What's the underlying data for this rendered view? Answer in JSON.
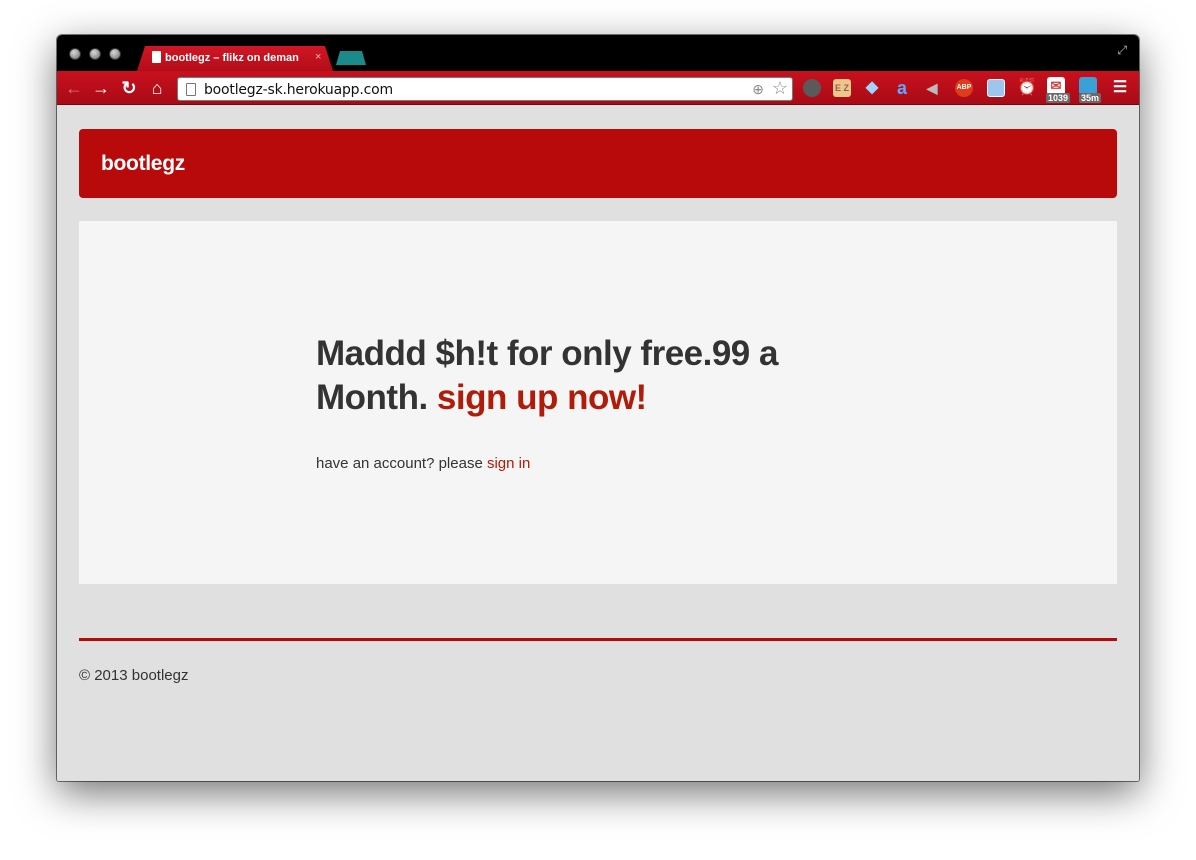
{
  "browser": {
    "tab_title": "bootlegz – flikz on deman",
    "tab_close": "×",
    "url": "bootlegz-sk.herokuapp.com",
    "extensions": [
      {
        "icon": "evernote-icon",
        "color": "#6a6a6a"
      },
      {
        "icon": "ez-icon",
        "color": "#d9b36a",
        "label": "E Z"
      },
      {
        "icon": "diamond-icon",
        "color": "#3aa0e0"
      },
      {
        "icon": "amazon-icon",
        "color": "#2a6fb0",
        "label": "a"
      },
      {
        "icon": "sound-icon",
        "color": "#7a7a7a"
      },
      {
        "icon": "adblock-icon",
        "color": "#e03b1a",
        "label": "ABP"
      },
      {
        "icon": "screen-icon",
        "color": "#4a8ad0"
      },
      {
        "icon": "alarm-icon",
        "color": "#3aa0e0"
      },
      {
        "icon": "mail-icon",
        "color": "#d04040",
        "badge": "1039"
      },
      {
        "icon": "timer-icon",
        "color": "#2a90c0",
        "badge": "35m"
      },
      {
        "icon": "menu-icon",
        "color": "#ffffff"
      }
    ]
  },
  "navbar": {
    "brand": "bootlegz"
  },
  "hero": {
    "heading": "Maddd $h!t for only free.99 a Month.",
    "cta_link": "sign up now!",
    "sub_text": "have an account? please",
    "signin_link": "sign in"
  },
  "footer": {
    "copyright": "© 2013 bootlegz"
  },
  "colors": {
    "brand_red": "#b80a0a",
    "link_red": "#b01c0a",
    "page_bg": "#e0e0e0",
    "hero_bg": "#f5f5f5"
  }
}
